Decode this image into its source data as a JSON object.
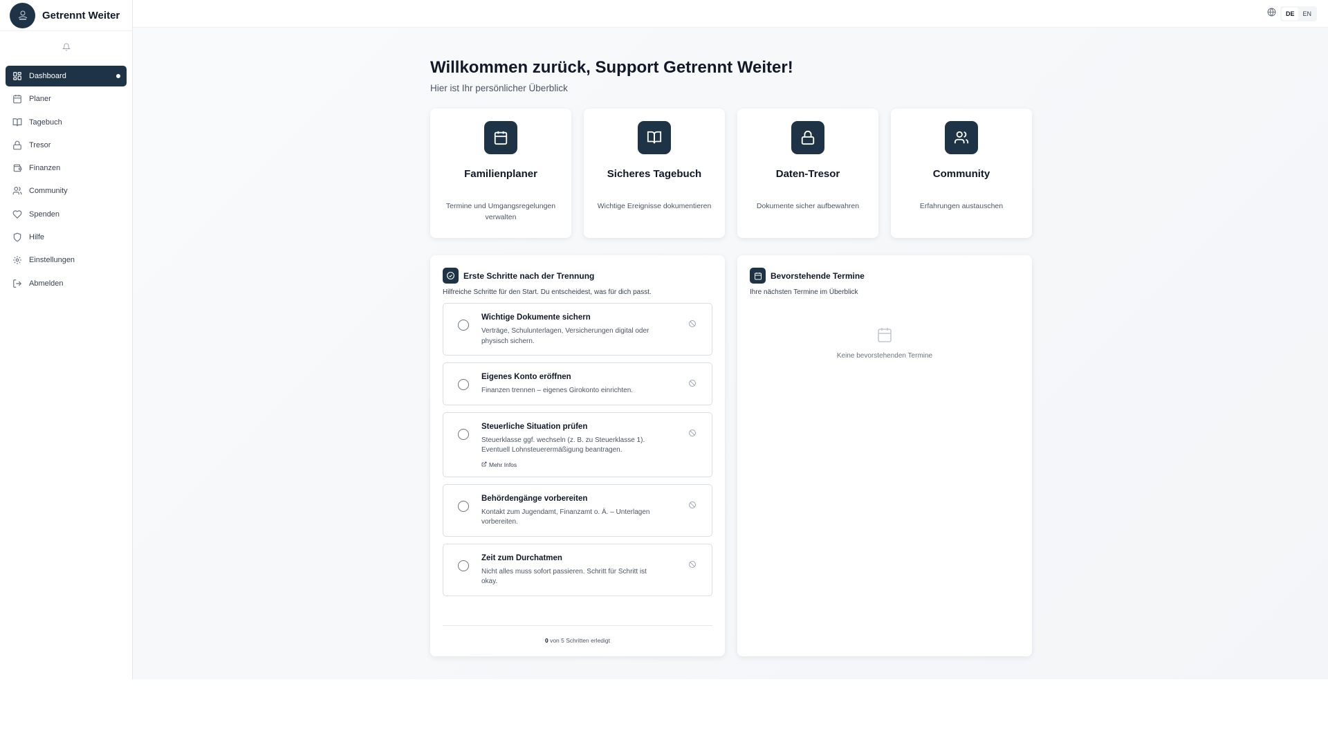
{
  "app": {
    "name": "Getrennt Weiter"
  },
  "topbar": {
    "languages": [
      "DE",
      "EN"
    ],
    "active_language": "DE"
  },
  "sidebar": {
    "items": [
      {
        "label": "Dashboard",
        "icon": "grid-icon"
      },
      {
        "label": "Planer",
        "icon": "calendar-icon"
      },
      {
        "label": "Tagebuch",
        "icon": "book-icon"
      },
      {
        "label": "Tresor",
        "icon": "lock-icon"
      },
      {
        "label": "Finanzen",
        "icon": "wallet-icon"
      },
      {
        "label": "Community",
        "icon": "users-icon"
      },
      {
        "label": "Spenden",
        "icon": "heart-icon"
      },
      {
        "label": "Hilfe",
        "icon": "shield-icon"
      },
      {
        "label": "Einstellungen",
        "icon": "gear-icon"
      },
      {
        "label": "Abmelden",
        "icon": "logout-icon"
      }
    ],
    "active": "Dashboard"
  },
  "main": {
    "welcome": "Willkommen zurück, Support Getrennt Weiter!",
    "subtitle": "Hier ist Ihr persönlicher Überblick",
    "cards": [
      {
        "title": "Familienplaner",
        "desc": "Termine und Umgangsregelungen verwalten",
        "icon": "calendar-icon"
      },
      {
        "title": "Sicheres Tagebuch",
        "desc": "Wichtige Ereignisse dokumentieren",
        "icon": "book-icon"
      },
      {
        "title": "Daten-Tresor",
        "desc": "Dokumente sicher aufbewahren",
        "icon": "lock-icon"
      },
      {
        "title": "Community",
        "desc": "Erfahrungen austauschen",
        "icon": "users-icon"
      }
    ],
    "steps_panel": {
      "title": "Erste Schritte nach der Trennung",
      "subtitle": "Hilfreiche Schritte für den Start. Du entscheidest, was für dich passt.",
      "steps": [
        {
          "title": "Wichtige Dokumente sichern",
          "desc": "Verträge, Schulunterlagen, Versicherungen digital oder physisch sichern."
        },
        {
          "title": "Eigenes Konto eröffnen",
          "desc": "Finanzen trennen – eigenes Girokonto einrichten."
        },
        {
          "title": "Steuerliche Situation prüfen",
          "desc": "Steuerklasse ggf. wechseln (z. B. zu Steuerklasse 1). Eventuell Lohnsteuerermäßigung beantragen.",
          "link": "Mehr Infos"
        },
        {
          "title": "Behördengänge vorbereiten",
          "desc": "Kontakt zum Jugendamt, Finanzamt o. Ä. – Unterlagen vorbereiten."
        },
        {
          "title": "Zeit zum Durchatmen",
          "desc": "Nicht alles muss sofort passieren. Schritt für Schritt ist okay."
        }
      ],
      "progress_done": "0",
      "progress_text": " von 5 Schritten erledigt"
    },
    "appointments_panel": {
      "title": "Bevorstehende Termine",
      "subtitle": "Ihre nächsten Termine im Überblick",
      "empty": "Keine bevorstehenden Termine"
    }
  },
  "colors": {
    "primary": "#1e3345",
    "background": "#f5f7fa"
  }
}
